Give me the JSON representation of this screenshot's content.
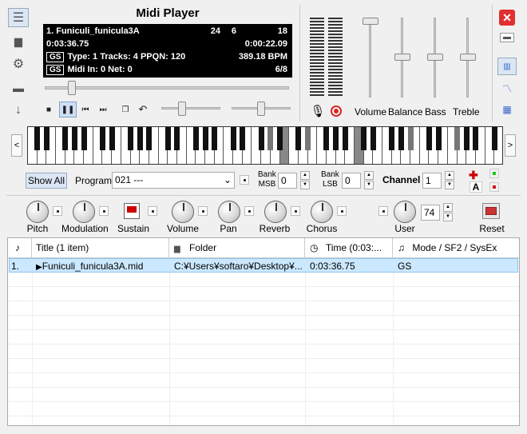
{
  "app": {
    "title": "Midi Player"
  },
  "display": {
    "track_line": "1.  Funiculi_funicula3A",
    "counter1": "24",
    "counter2": "6",
    "counter3": "18",
    "position": "0:03:36.75",
    "remaining": "0:00:22.09",
    "gs_badge": "GS",
    "info": "Type: 1 Tracks: 4 PPQN: 120",
    "bpm": "389.18 BPM",
    "gs_badge2": "GS",
    "midi_info": "Midi In: 0  Net: 0",
    "time_sig": "6/8"
  },
  "mixer": {
    "volume_label": "Volume",
    "balance_label": "Balance",
    "bass_label": "Bass",
    "treble_label": "Treble"
  },
  "program_bar": {
    "show_all_label": "Show All",
    "program_label": "Program",
    "program_value": "021 ---",
    "bank_msb_label1": "Bank",
    "bank_msb_label2": "MSB",
    "bank_msb_value": "0",
    "bank_lsb_label1": "Bank",
    "bank_lsb_label2": "LSB",
    "bank_lsb_value": "0",
    "channel_label": "Channel",
    "channel_value": "1",
    "a_label": "A"
  },
  "controls": {
    "pitch_label": "Pitch",
    "modulation_label": "Modulation",
    "sustain_label": "Sustain",
    "volume_label": "Volume",
    "pan_label": "Pan",
    "reverb_label": "Reverb",
    "chorus_label": "Chorus",
    "user_label": "User",
    "user_value": "74",
    "reset_label": "Reset"
  },
  "playlist": {
    "columns": [
      "Title  (1 item)",
      "Folder",
      "Time (0:03:...",
      "Mode / SF2 / SysEx"
    ],
    "rows": [
      {
        "num": "1.",
        "title": "Funiculi_funicula3A.mid",
        "folder": "C:¥Users¥softaro¥Desktop¥...",
        "time": "0:03:36.75",
        "mode": "GS"
      }
    ]
  },
  "colors": {
    "selection": "#cce8ff",
    "close_red": "#e03030"
  }
}
